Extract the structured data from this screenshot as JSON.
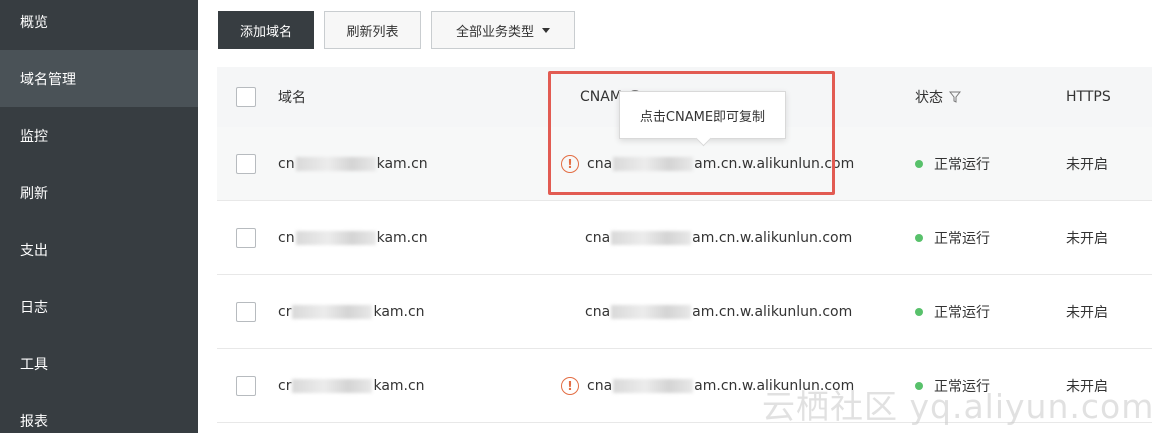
{
  "sidebar": {
    "items": [
      {
        "label": "概览",
        "icon": ""
      },
      {
        "label": "域名管理",
        "active": true
      },
      {
        "label": "监控"
      },
      {
        "label": "刷新"
      },
      {
        "label": "支出"
      },
      {
        "label": "日志"
      },
      {
        "label": "工具"
      },
      {
        "label": "报表"
      }
    ]
  },
  "toolbar": {
    "add_domain": "添加域名",
    "refresh_list": "刷新列表",
    "business_type": "全部业务类型"
  },
  "table": {
    "headers": {
      "domain": "域名",
      "cname": "CNAM",
      "status": "状态",
      "https": "HTTPS"
    },
    "rows": [
      {
        "domain_prefix": "cn",
        "domain_suffix": "kam.cn",
        "cname_prefix": "cna",
        "cname_suffix": "am.cn.w.alikunlun.com",
        "warning": true,
        "status": "正常运行",
        "https": "未开启"
      },
      {
        "domain_prefix": "cn",
        "domain_suffix": "kam.cn",
        "cname_prefix": "cna",
        "cname_suffix": "am.cn.w.alikunlun.com",
        "warning": false,
        "status": "正常运行",
        "https": "未开启"
      },
      {
        "domain_prefix": "cr",
        "domain_suffix": "kam.cn",
        "cname_prefix": "cna",
        "cname_suffix": "am.cn.w.alikunlun.com",
        "warning": false,
        "status": "正常运行",
        "https": "未开启"
      },
      {
        "domain_prefix": "cr",
        "domain_suffix": "kam.cn",
        "cname_prefix": "cna",
        "cname_suffix": "am.cn.w.alikunlun.com",
        "warning": true,
        "status": "正常运行",
        "https": "未开启"
      }
    ]
  },
  "tooltip": {
    "text": "点击CNAME即可复制"
  },
  "watermark": "云栖社区 yq.aliyun.com",
  "colors": {
    "sidebar_bg": "#373d41",
    "highlight": "#e25b52",
    "warning": "#e36d43",
    "status_ok": "#58c16b"
  },
  "icons": {
    "warning": "exclamation-circle-icon",
    "help": "question-circle-icon",
    "filter": "filter-icon",
    "dropdown": "caret-down-icon"
  }
}
